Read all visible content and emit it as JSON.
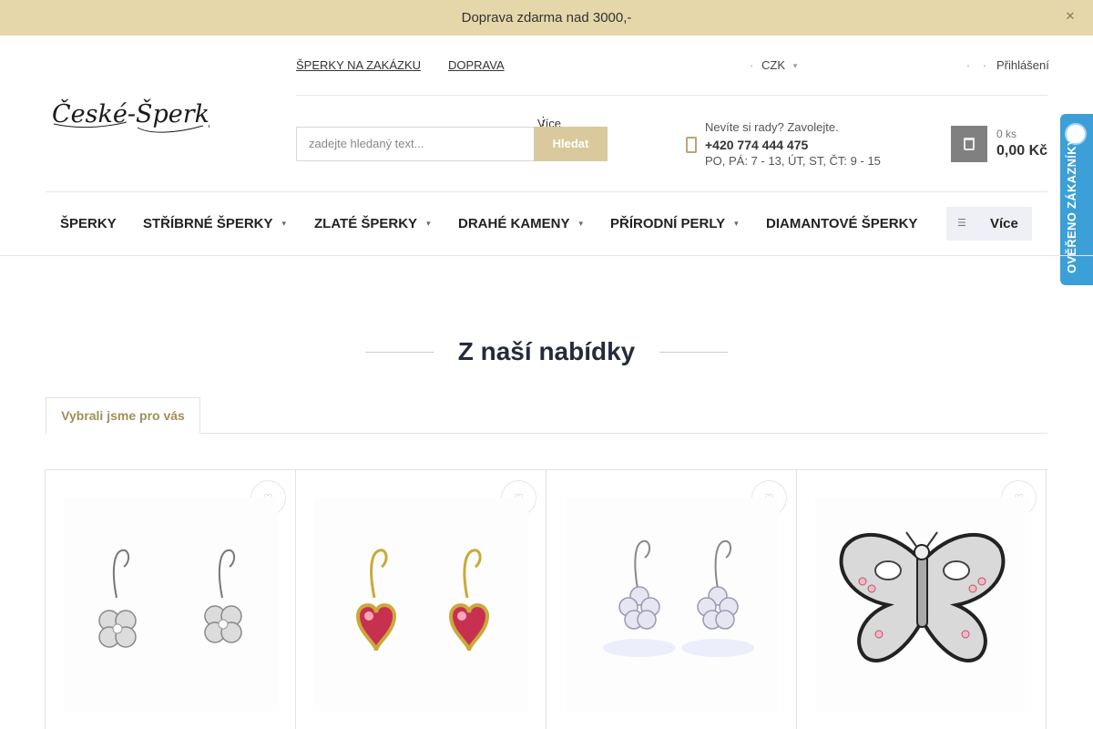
{
  "topbar": {
    "message": "Doprava zdarma nad 3000,-",
    "close_icon": "close-icon"
  },
  "header": {
    "logo_text": "České-Šperky",
    "links": [
      "ŠPERKY NA ZAKÁZKU",
      "DOPRAVA",
      "Více"
    ],
    "currency": "CZK",
    "login": "Přihlášení",
    "search": {
      "placeholder": "zadejte hledaný text...",
      "button": "Hledat"
    },
    "contact": {
      "question": "Nevíte si rady? Zavolejte.",
      "phone": "+420 774 444 475",
      "hours": "PO, PÁ: 7 - 13, ÚT, ST, ČT: 9 - 15"
    },
    "cart": {
      "count": "0 ks",
      "total": "0,00 Kč"
    },
    "badge": "OVĚŘENO ZÁKAZNÍKY"
  },
  "nav": {
    "items": [
      "ŠPERKY",
      "STŘÍBRNÉ ŠPERKY",
      "ZLATÉ ŠPERKY",
      "DRAHÉ KAMENY",
      "PŘÍRODNÍ PERLY",
      "DIAMANTOVÉ ŠPERKY"
    ],
    "more": "Více"
  },
  "section": {
    "title": "Z naší nabídky",
    "tab": "Vybrali jsme pro vás"
  },
  "products": [
    {
      "image": "silver-clover-earrings"
    },
    {
      "image": "gold-ruby-heart-earrings"
    },
    {
      "image": "silver-crystal-flower-earrings"
    },
    {
      "image": "silver-butterfly-pendant"
    }
  ],
  "colors": {
    "topbar": "#e5d7aa",
    "accent": "#d9c99c",
    "badge": "#3d9fd8"
  }
}
